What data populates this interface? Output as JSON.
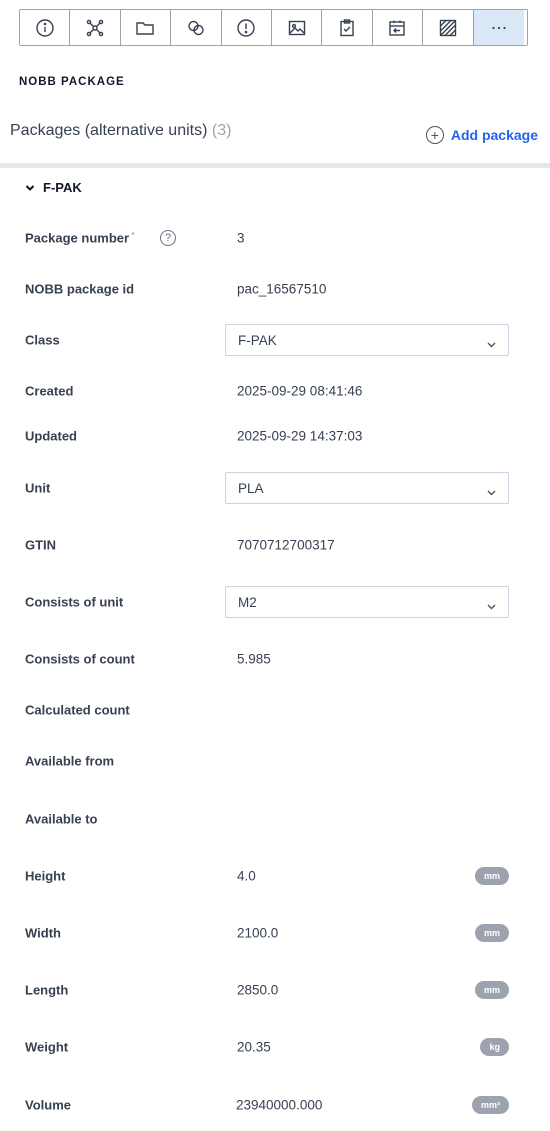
{
  "toolbar": {
    "buttons": [
      {
        "icon": "info-icon"
      },
      {
        "icon": "nodes-icon"
      },
      {
        "icon": "folder-icon"
      },
      {
        "icon": "link-circles-icon"
      },
      {
        "icon": "alert-icon"
      },
      {
        "icon": "image-icon"
      },
      {
        "icon": "clipboard-check-icon"
      },
      {
        "icon": "calendar-import-icon"
      },
      {
        "icon": "hatch-icon"
      },
      {
        "icon": "more-icon"
      }
    ]
  },
  "section": {
    "title": "NOBB PACKAGE"
  },
  "packages": {
    "header": "Packages (alternative units)",
    "count": "(3)",
    "add_label": "Add package"
  },
  "group": {
    "title": "F-PAK"
  },
  "fields": {
    "package_number": {
      "label": "Package number",
      "required": "*",
      "value": "3"
    },
    "nobb_id": {
      "label": "NOBB package id",
      "value": "pac_16567510"
    },
    "class": {
      "label": "Class",
      "value": "F-PAK"
    },
    "created": {
      "label": "Created",
      "value": "2025-09-29 08:41:46"
    },
    "updated": {
      "label": "Updated",
      "value": "2025-09-29 14:37:03"
    },
    "unit": {
      "label": "Unit",
      "value": "PLA"
    },
    "gtin": {
      "label": "GTIN",
      "value": "7070712700317"
    },
    "consists_unit": {
      "label": "Consists of unit",
      "value": "M2"
    },
    "consists_count": {
      "label": "Consists of count",
      "value": "5.985"
    },
    "calculated_count": {
      "label": "Calculated count",
      "value": ""
    },
    "available_from": {
      "label": "Available from",
      "value": ""
    },
    "available_to": {
      "label": "Available to",
      "value": ""
    },
    "height": {
      "label": "Height",
      "value": "4.0",
      "unit": "mm"
    },
    "width": {
      "label": "Width",
      "value": "2100.0",
      "unit": "mm"
    },
    "length": {
      "label": "Length",
      "value": "2850.0",
      "unit": "mm"
    },
    "weight": {
      "label": "Weight",
      "value": "20.35",
      "unit": "kg"
    },
    "volume": {
      "label": "Volume",
      "value": "23940000.000",
      "unit": "mm³"
    }
  }
}
